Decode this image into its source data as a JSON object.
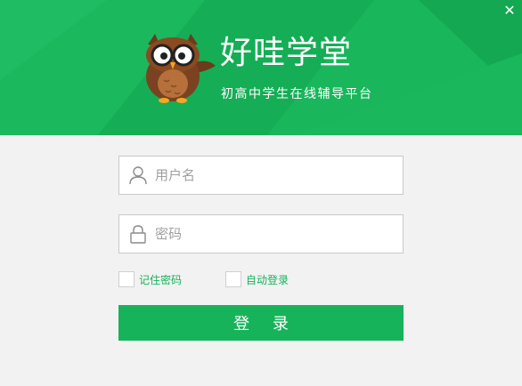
{
  "header": {
    "title": "好哇学堂",
    "subtitle": "初高中学生在线辅导平台",
    "close_icon": "close-icon",
    "mascot_icon": "owl-mascot-icon"
  },
  "form": {
    "username": {
      "placeholder": "用户名",
      "value": "",
      "icon": "user-icon"
    },
    "password": {
      "placeholder": "密码",
      "value": "",
      "icon": "lock-icon"
    },
    "remember_password": {
      "label": "记住密码",
      "checked": false
    },
    "auto_login": {
      "label": "自动登录",
      "checked": false
    },
    "login_button": "登 录"
  },
  "colors": {
    "brand": "#17b35a",
    "background": "#f2f2f2",
    "input_border": "#c9c9c9"
  }
}
